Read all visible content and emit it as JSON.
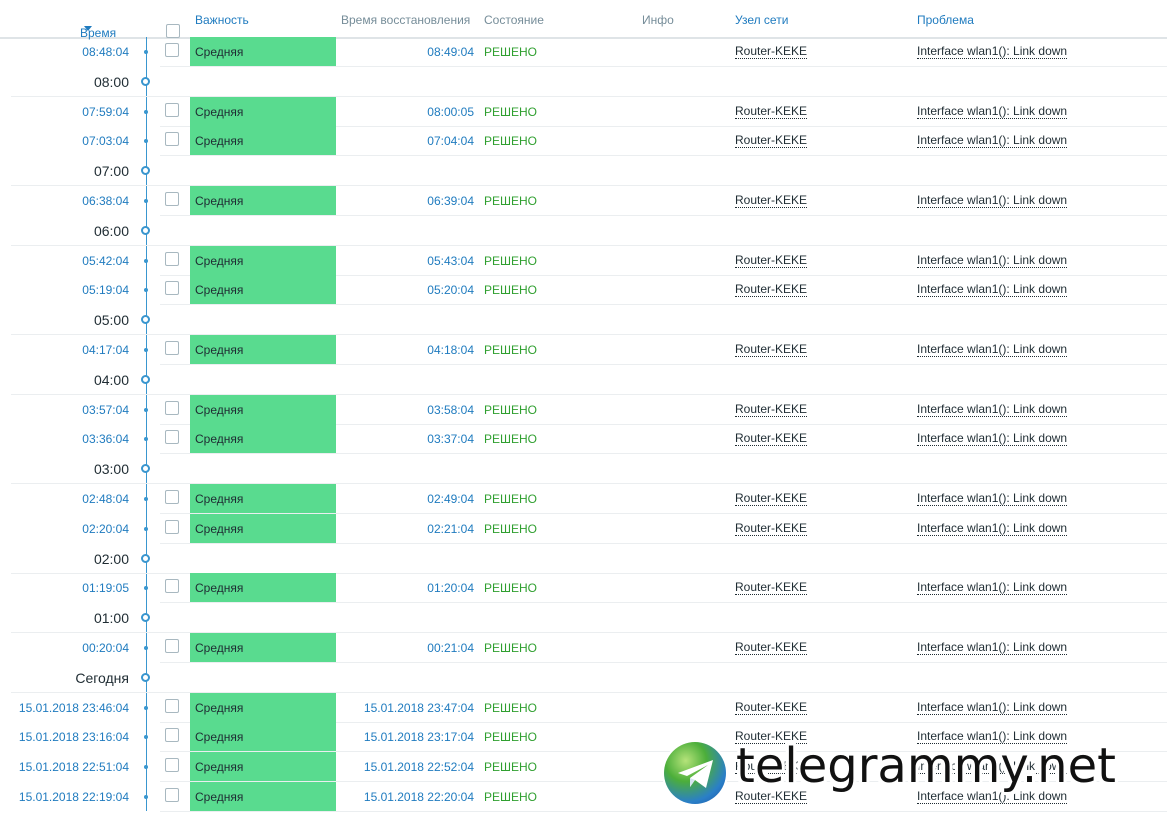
{
  "header": {
    "time": "Время",
    "severity": "Важность",
    "recovery_time": "Время восстановления",
    "status": "Состояние",
    "info": "Инфо",
    "host": "Узел сети",
    "problem": "Проблема"
  },
  "colors": {
    "link": "#1f7bbf",
    "severity_average": "#59db8f",
    "resolved": "#2f9f2f",
    "timeline": "#3996cf"
  },
  "rows": [
    {
      "type": "event",
      "time": "08:48:04",
      "severity": "Средняя",
      "recovery": "08:49:04",
      "status": "РЕШЕНО",
      "host": "Router-KEKE",
      "problem": "Interface wlan1(): Link down"
    },
    {
      "type": "group",
      "label": "08:00"
    },
    {
      "type": "event",
      "time": "07:59:04",
      "severity": "Средняя",
      "recovery": "08:00:05",
      "status": "РЕШЕНО",
      "host": "Router-KEKE",
      "problem": "Interface wlan1(): Link down"
    },
    {
      "type": "event",
      "time": "07:03:04",
      "severity": "Средняя",
      "recovery": "07:04:04",
      "status": "РЕШЕНО",
      "host": "Router-KEKE",
      "problem": "Interface wlan1(): Link down"
    },
    {
      "type": "group",
      "label": "07:00"
    },
    {
      "type": "event",
      "time": "06:38:04",
      "severity": "Средняя",
      "recovery": "06:39:04",
      "status": "РЕШЕНО",
      "host": "Router-KEKE",
      "problem": "Interface wlan1(): Link down"
    },
    {
      "type": "group",
      "label": "06:00"
    },
    {
      "type": "event",
      "time": "05:42:04",
      "severity": "Средняя",
      "recovery": "05:43:04",
      "status": "РЕШЕНО",
      "host": "Router-KEKE",
      "problem": "Interface wlan1(): Link down"
    },
    {
      "type": "event",
      "time": "05:19:04",
      "severity": "Средняя",
      "recovery": "05:20:04",
      "status": "РЕШЕНО",
      "host": "Router-KEKE",
      "problem": "Interface wlan1(): Link down"
    },
    {
      "type": "group",
      "label": "05:00"
    },
    {
      "type": "event",
      "time": "04:17:04",
      "severity": "Средняя",
      "recovery": "04:18:04",
      "status": "РЕШЕНО",
      "host": "Router-KEKE",
      "problem": "Interface wlan1(): Link down"
    },
    {
      "type": "group",
      "label": "04:00"
    },
    {
      "type": "event",
      "time": "03:57:04",
      "severity": "Средняя",
      "recovery": "03:58:04",
      "status": "РЕШЕНО",
      "host": "Router-KEKE",
      "problem": "Interface wlan1(): Link down"
    },
    {
      "type": "event",
      "time": "03:36:04",
      "severity": "Средняя",
      "recovery": "03:37:04",
      "status": "РЕШЕНО",
      "host": "Router-KEKE",
      "problem": "Interface wlan1(): Link down"
    },
    {
      "type": "group",
      "label": "03:00"
    },
    {
      "type": "event",
      "time": "02:48:04",
      "severity": "Средняя",
      "recovery": "02:49:04",
      "status": "РЕШЕНО",
      "host": "Router-KEKE",
      "problem": "Interface wlan1(): Link down"
    },
    {
      "type": "event",
      "time": "02:20:04",
      "severity": "Средняя",
      "recovery": "02:21:04",
      "status": "РЕШЕНО",
      "host": "Router-KEKE",
      "problem": "Interface wlan1(): Link down"
    },
    {
      "type": "group",
      "label": "02:00"
    },
    {
      "type": "event",
      "time": "01:19:05",
      "severity": "Средняя",
      "recovery": "01:20:04",
      "status": "РЕШЕНО",
      "host": "Router-KEKE",
      "problem": "Interface wlan1(): Link down"
    },
    {
      "type": "group",
      "label": "01:00"
    },
    {
      "type": "event",
      "time": "00:20:04",
      "severity": "Средняя",
      "recovery": "00:21:04",
      "status": "РЕШЕНО",
      "host": "Router-KEKE",
      "problem": "Interface wlan1(): Link down"
    },
    {
      "type": "group",
      "label": "Сегодня"
    },
    {
      "type": "event",
      "time": "15.01.2018 23:46:04",
      "severity": "Средняя",
      "recovery": "15.01.2018 23:47:04",
      "status": "РЕШЕНО",
      "host": "Router-KEKE",
      "problem": "Interface wlan1(): Link down"
    },
    {
      "type": "event",
      "time": "15.01.2018 23:16:04",
      "severity": "Средняя",
      "recovery": "15.01.2018 23:17:04",
      "status": "РЕШЕНО",
      "host": "Router-KEKE",
      "problem": "Interface wlan1(): Link down"
    },
    {
      "type": "event",
      "time": "15.01.2018 22:51:04",
      "severity": "Средняя",
      "recovery": "15.01.2018 22:52:04",
      "status": "РЕШЕНО",
      "host": "Router-KEKE",
      "problem": "Interface wlan1(): Link down"
    },
    {
      "type": "event",
      "time": "15.01.2018 22:19:04",
      "severity": "Средняя",
      "recovery": "15.01.2018 22:20:04",
      "status": "РЕШЕНО",
      "host": "Router-KEKE",
      "problem": "Interface wlan1(): Link down"
    }
  ],
  "watermark": {
    "text": "telegrammy.net",
    "icon": "telegram-logo-icon"
  }
}
